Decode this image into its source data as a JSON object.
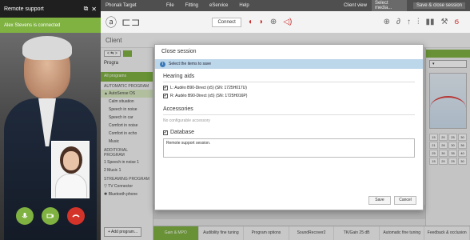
{
  "remote": {
    "title": "Remote support",
    "status": "Alex Stevens is connected",
    "controls": {
      "mic": "microphone-icon",
      "camera": "camera-icon",
      "end": "end-call-icon"
    }
  },
  "app": {
    "brand": "Phonak Target",
    "menus": [
      "File",
      "Fitting",
      "eService",
      "Help"
    ],
    "client_view": "Client view",
    "media_placeholder": "Select media...",
    "save_close": "Save & close session",
    "connect": "Connect",
    "client_label": "Client"
  },
  "sidebar": {
    "program_header": "Progra",
    "all_programs": "All programs",
    "automatic_head": "AUTOMATIC PROGRAM",
    "items_auto": [
      "AutoSense OS",
      "Calm situation",
      "Speech in noise",
      "Speech in car",
      "Comfort in noise",
      "Comfort in echo",
      "Music"
    ],
    "additional_head": "ADDITIONAL PROGRAM",
    "items_additional": [
      "Speech in noise 1",
      "Music 1"
    ],
    "streaming_head": "STREAMING PROGRAM",
    "items_streaming": [
      "TV Connector",
      "Bluetooth phone"
    ],
    "add_label": "+ Add program..."
  },
  "bottom_tabs": [
    "Gain & MPO",
    "Audibility fine tuning",
    "Program options",
    "SoundRecover2",
    "TK/Gain 25 dB",
    "Automatic fine tuning",
    "Feedback & occlusion"
  ],
  "right_grid": [
    "15",
    "20",
    "25",
    "30",
    "21",
    "26",
    "30",
    "36",
    "25",
    "30",
    "35",
    "40",
    "15",
    "20",
    "25",
    "30"
  ],
  "modal": {
    "title": "Close session",
    "info": "Select the items to save",
    "hearing_aids_title": "Hearing aids",
    "device_left": "L: Audéo B90-Direct (x5) (SN: 1725H017U)",
    "device_right": "R: Audéo B90-Direct (x5) (SN: 1725H016P)",
    "accessories_title": "Accessories",
    "accessories_empty": "No configurable accessory",
    "database_title": "Database",
    "notes": "Remote support session.",
    "save": "Save",
    "cancel": "Cancel"
  }
}
